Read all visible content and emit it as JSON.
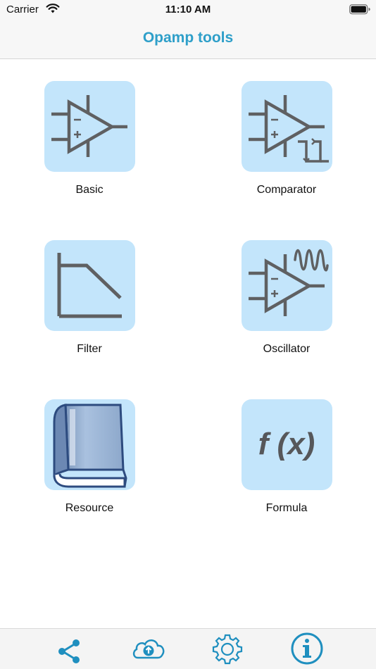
{
  "status_bar": {
    "carrier": "Carrier",
    "time": "11:10 AM",
    "icons": [
      "wifi-icon",
      "battery-icon"
    ]
  },
  "nav": {
    "title": "Opamp tools"
  },
  "tiles": [
    {
      "label": "Basic",
      "icon": "opamp-icon"
    },
    {
      "label": "Comparator",
      "icon": "comparator-icon"
    },
    {
      "label": "Filter",
      "icon": "filter-response-icon"
    },
    {
      "label": "Oscillator",
      "icon": "oscillator-icon"
    },
    {
      "label": "Resource",
      "icon": "book-icon"
    },
    {
      "label": "Formula",
      "icon": "function-icon",
      "glyph": "f (x)"
    }
  ],
  "tab_bar": {
    "icons": [
      "share-icon",
      "cloud-upload-icon",
      "settings-gear-icon",
      "info-icon"
    ]
  },
  "colors": {
    "accent": "#2e9fc9",
    "tile_bg": "#c3e5fb",
    "icon_stroke": "#5f6062",
    "tab_icon": "#1f8fbf"
  }
}
